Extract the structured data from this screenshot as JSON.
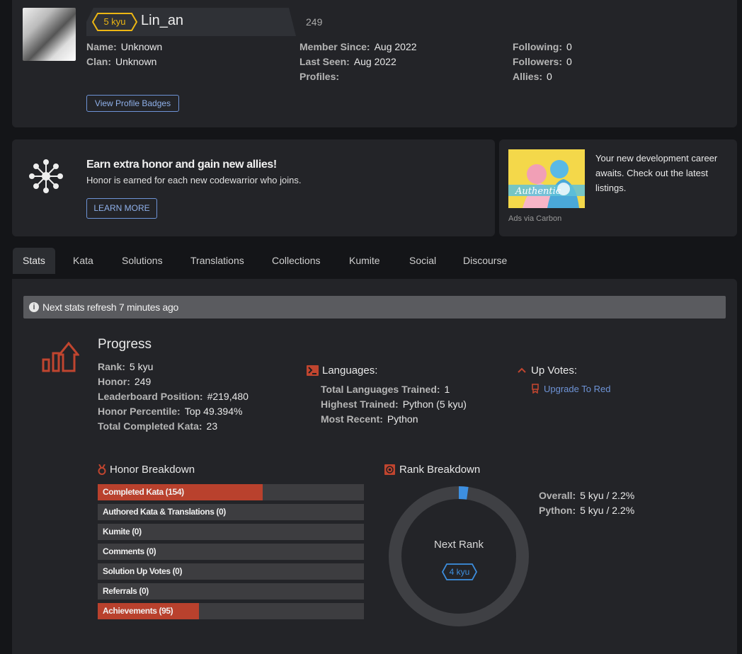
{
  "profile": {
    "rank_badge": "5 kyu",
    "username": "Lin_an",
    "honor": "249",
    "name_label": "Name:",
    "name": "Unknown",
    "clan_label": "Clan:",
    "clan": "Unknown",
    "member_since_label": "Member Since:",
    "member_since": "Aug 2022",
    "last_seen_label": "Last Seen:",
    "last_seen": "Aug 2022",
    "profiles_label": "Profiles:",
    "following_label": "Following:",
    "following": "0",
    "followers_label": "Followers:",
    "followers": "0",
    "allies_label": "Allies:",
    "allies": "0",
    "badges_button": "View Profile Badges"
  },
  "promo": {
    "title": "Earn extra honor and gain new allies!",
    "text": "Honor is earned for each new codewarrior who joins.",
    "button": "LEARN MORE",
    "icon": "network-icon"
  },
  "ad": {
    "text": "Your new development career awaits. Check out the latest listings.",
    "image_text": "Authentic",
    "via": "Ads via Carbon"
  },
  "tabs": [
    "Stats",
    "Kata",
    "Solutions",
    "Translations",
    "Collections",
    "Kumite",
    "Social",
    "Discourse"
  ],
  "refresh": "Next stats refresh 7 minutes ago",
  "progress": {
    "title": "Progress",
    "rank_label": "Rank:",
    "rank": "5 kyu",
    "honor_label": "Honor:",
    "honor": "249",
    "leaderboard_label": "Leaderboard Position:",
    "leaderboard": "#219,480",
    "percentile_label": "Honor Percentile:",
    "percentile": "Top 49.394%",
    "completed_label": "Total Completed Kata:",
    "completed": "23"
  },
  "languages": {
    "title": "Languages:",
    "total_label": "Total Languages Trained:",
    "total": "1",
    "highest_label": "Highest Trained:",
    "highest": "Python (5 kyu)",
    "recent_label": "Most Recent:",
    "recent": "Python"
  },
  "upvotes": {
    "title": "Up Votes:",
    "link": "Upgrade To Red"
  },
  "honor_breakdown": {
    "title": "Honor Breakdown",
    "items": [
      {
        "label": "Completed Kata (154)",
        "fraction": 0.62
      },
      {
        "label": "Authored Kata & Translations (0)",
        "fraction": 0
      },
      {
        "label": "Kumite (0)",
        "fraction": 0
      },
      {
        "label": "Comments (0)",
        "fraction": 0
      },
      {
        "label": "Solution Up Votes (0)",
        "fraction": 0
      },
      {
        "label": "Referrals (0)",
        "fraction": 0
      },
      {
        "label": "Achievements (95)",
        "fraction": 0.38
      }
    ]
  },
  "rank_breakdown": {
    "title": "Rank Breakdown",
    "center_label": "Next Rank",
    "next_rank": "4 kyu",
    "progress_fraction": 0.022,
    "overall_label": "Overall:",
    "overall": "5 kyu / 2.2%",
    "python_label": "Python:",
    "python": "5 kyu / 2.2%"
  },
  "colors": {
    "accent_red": "#b9412d",
    "kyu_yellow": "#ecb613",
    "kyu_blue": "#3d8fe0",
    "link_blue": "#6e93d6"
  }
}
